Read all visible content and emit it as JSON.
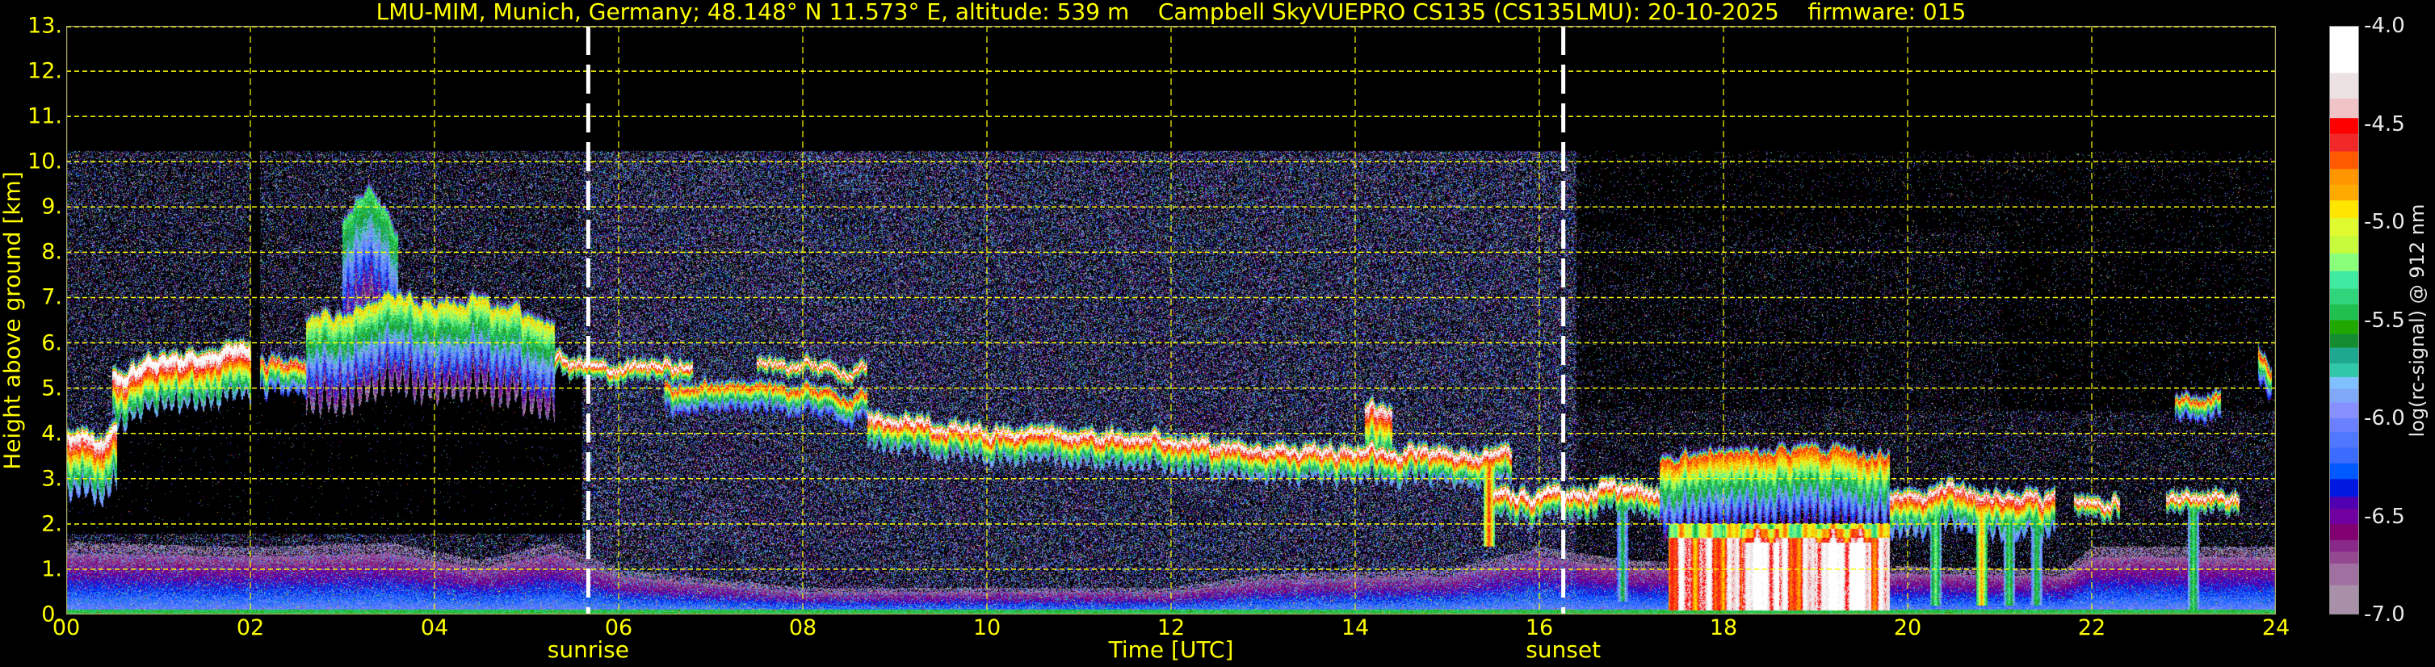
{
  "title": "LMU-MIM, Munich, Germany; 48.148° N 11.573° E, altitude: 539 m    Campbell SkyVUEPRO CS135 (CS135LMU): 20-10-2025    firmware: 015",
  "chart_data": {
    "type": "heatmap",
    "title": "LMU-MIM, Munich, Germany; 48.148° N 11.573° E, altitude: 539 m    Campbell SkyVUEPRO CS135 (CS135LMU): 20-10-2025    firmware: 015",
    "xlabel": "Time [UTC]",
    "ylabel": "Height above ground [km]",
    "xlim": [
      0,
      24
    ],
    "ylim": [
      0,
      13
    ],
    "x_ticks": [
      0,
      2,
      4,
      6,
      8,
      10,
      12,
      14,
      16,
      18,
      20,
      22,
      24
    ],
    "x_tick_labels": [
      "00",
      "02",
      "04",
      "06",
      "08",
      "10",
      "12",
      "14",
      "16",
      "18",
      "20",
      "22",
      "24"
    ],
    "y_ticks": [
      0,
      1,
      2,
      3,
      4,
      5,
      6,
      7,
      8,
      9,
      10,
      11,
      12,
      13
    ],
    "y_tick_labels": [
      "0.",
      "1.",
      "2.",
      "3.",
      "4.",
      "5.",
      "6.",
      "7.",
      "8.",
      "9.",
      "10.",
      "11.",
      "12.",
      "13."
    ],
    "grid": true,
    "grid_color": "#ffff00",
    "markers": [
      {
        "label": "sunrise",
        "time": 5.67,
        "color": "#ffffff"
      },
      {
        "label": "sunset",
        "time": 16.26,
        "color": "#ffffff"
      }
    ],
    "colorbar": {
      "label": "log(rc-signal) @ 912 nm",
      "range": [
        -7.0,
        -4.0
      ],
      "ticks": [
        -4.0,
        -4.5,
        -5.0,
        -5.5,
        -6.0,
        -6.5,
        -7.0
      ],
      "tick_labels": [
        "-4.0",
        "-4.5",
        "-5.0",
        "-5.5",
        "-6.0",
        "-6.5",
        "-7.0"
      ],
      "bounds": [
        -4.0,
        -4.24,
        -4.37,
        -4.47,
        -4.55,
        -4.64,
        -4.73,
        -4.81,
        -4.89,
        -4.98,
        -5.07,
        -5.16,
        -5.25,
        -5.34,
        -5.42,
        -5.5,
        -5.57,
        -5.64,
        -5.72,
        -5.79,
        -5.85,
        -5.92,
        -6.0,
        -6.07,
        -6.15,
        -6.23,
        -6.31,
        -6.4,
        -6.46,
        -6.54,
        -6.62,
        -6.68,
        -6.74,
        -6.85,
        -7.0
      ],
      "colors": [
        "#ffffff",
        "#ece2e4",
        "#f0c4c6",
        "#ff0000",
        "#f02828",
        "#ff5a00",
        "#ff9600",
        "#ffaa00",
        "#ffe600",
        "#e0fa30",
        "#c8fa3c",
        "#8aff7a",
        "#40eaa0",
        "#30d47a",
        "#20c050",
        "#20a800",
        "#148c30",
        "#1ea890",
        "#30c8a8",
        "#80c0ff",
        "#80a8f8",
        "#8890ff",
        "#6a80ff",
        "#5078ff",
        "#3c6cff",
        "#0058ff",
        "#0018e0",
        "#5000b0",
        "#7000a0",
        "#800070",
        "#882888",
        "#944890",
        "#a070a0",
        "#a890a8"
      ]
    },
    "signal_top_km": 10.25,
    "boundary_layer": {
      "time": [
        0,
        2,
        3.5,
        4.5,
        5.3,
        6,
        8,
        10,
        12,
        13,
        15,
        16,
        17,
        21.7,
        22,
        24
      ],
      "top_km": [
        1.6,
        1.5,
        1.6,
        1.2,
        1.6,
        1.0,
        0.6,
        0.6,
        0.6,
        0.9,
        1.0,
        1.5,
        1.2,
        1.0,
        1.5,
        1.5
      ]
    },
    "cloud_layers": [
      {
        "time": [
          0,
          0.2,
          0.4,
          0.55
        ],
        "height_km": [
          3.9,
          4.0,
          3.8,
          4.1
        ],
        "depth_km": 1.2,
        "peak": -4.1
      },
      {
        "time": [
          0.5,
          0.8,
          1.2,
          1.6,
          2.0
        ],
        "height_km": [
          5.2,
          5.5,
          5.6,
          5.8,
          5.9
        ],
        "depth_km": 1.0,
        "peak": -4.0
      },
      {
        "time": [
          2.1,
          2.6
        ],
        "height_km": [
          5.6,
          5.5
        ],
        "depth_km": 0.6,
        "peak": -4.4
      },
      {
        "time": [
          2.6,
          3.5,
          4.5,
          5.3
        ],
        "height_km": [
          6.5,
          6.9,
          6.9,
          6.3
        ],
        "depth_km": 1.8,
        "peak": -4.9
      },
      {
        "time": [
          3.0,
          3.3,
          3.6
        ],
        "height_km": [
          8.8,
          9.4,
          8.2
        ],
        "depth_km": 3.0,
        "peak": -5.3
      },
      {
        "time": [
          5.3,
          6.0,
          6.8
        ],
        "height_km": [
          5.6,
          5.5,
          5.5
        ],
        "depth_km": 0.3,
        "peak": -4.0
      },
      {
        "time": [
          6.5,
          7.5,
          8.7
        ],
        "height_km": [
          5.0,
          5.0,
          4.9
        ],
        "depth_km": 0.5,
        "peak": -4.5
      },
      {
        "time": [
          7.5,
          8.7
        ],
        "height_km": [
          5.5,
          5.5
        ],
        "depth_km": 0.2,
        "peak": -4.0
      },
      {
        "time": [
          8.7,
          9.5,
          10.5,
          11.5,
          12.5,
          13.5,
          14.0,
          15.0,
          15.7
        ],
        "height_km": [
          4.4,
          4.2,
          4.0,
          3.9,
          3.7,
          3.6,
          3.7,
          3.6,
          3.6
        ],
        "depth_km": 0.6,
        "peak": -4.1
      },
      {
        "time": [
          14.1,
          14.4
        ],
        "height_km": [
          4.6,
          4.6
        ],
        "depth_km": 1.2,
        "peak": -4.2
      },
      {
        "time": [
          15.5,
          16.0,
          16.5,
          17.0,
          17.3
        ],
        "height_km": [
          2.7,
          2.6,
          2.8,
          2.8,
          2.7
        ],
        "depth_km": 0.5,
        "peak": -4.0
      },
      {
        "time": [
          17.3,
          18.0,
          19.0,
          19.8
        ],
        "height_km": [
          3.4,
          3.6,
          3.6,
          3.4
        ],
        "depth_km": 1.5,
        "peak": -4.6
      },
      {
        "time": [
          19.8,
          20.5,
          21.0,
          21.6
        ],
        "height_km": [
          2.6,
          2.8,
          2.6,
          2.6
        ],
        "depth_km": 0.8,
        "peak": -4.2
      },
      {
        "time": [
          21.8,
          22.3
        ],
        "height_km": [
          2.5,
          2.5
        ],
        "depth_km": 0.3,
        "peak": -4.0
      },
      {
        "time": [
          22.8,
          23.2,
          23.6
        ],
        "height_km": [
          2.6,
          2.7,
          2.5
        ],
        "depth_km": 0.3,
        "peak": -4.0
      },
      {
        "time": [
          22.9,
          23.4
        ],
        "height_km": [
          4.8,
          4.8
        ],
        "depth_km": 0.4,
        "peak": -4.5
      },
      {
        "time": [
          23.8,
          23.95
        ],
        "height_km": [
          5.8,
          5.4
        ],
        "depth_km": 0.6,
        "peak": -4.5
      }
    ],
    "precipitation": [
      {
        "time": [
          17.4,
          19.8
        ],
        "top_km": 2.0,
        "peak": -4.5
      },
      {
        "time": [
          18.2,
          18.6
        ],
        "top_km": 1.9,
        "peak": -4.15
      },
      {
        "time": [
          19.0,
          19.6
        ],
        "top_km": 1.9,
        "peak": -4.15
      }
    ],
    "fall_streaks": [
      {
        "time": 15.45,
        "top_km": 3.5,
        "bottom_km": 1.5,
        "peak": -4.6
      },
      {
        "time": 16.9,
        "top_km": 2.5,
        "bottom_km": 0.3,
        "peak": -5.5
      },
      {
        "time": 20.3,
        "top_km": 2.6,
        "bottom_km": 0.2,
        "peak": -5.2
      },
      {
        "time": 20.8,
        "top_km": 2.6,
        "bottom_km": 0.2,
        "peak": -4.8
      },
      {
        "time": 21.1,
        "top_km": 2.6,
        "bottom_km": 0.2,
        "peak": -5.3
      },
      {
        "time": 21.4,
        "top_km": 2.6,
        "bottom_km": 0.2,
        "peak": -5.4
      },
      {
        "time": 23.1,
        "top_km": 2.6,
        "bottom_km": 0.1,
        "peak": -5.3
      }
    ]
  }
}
